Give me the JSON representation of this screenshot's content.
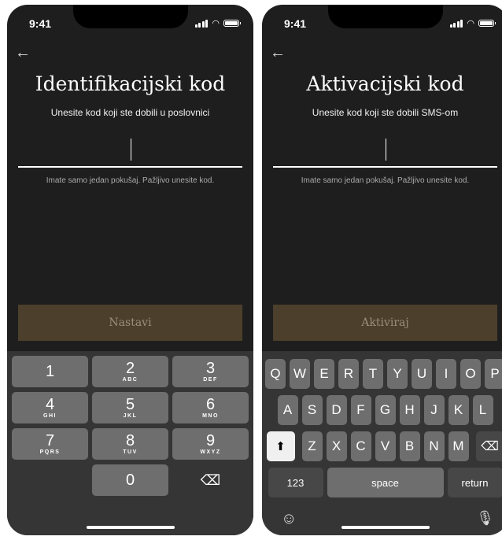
{
  "status": {
    "time": "9:41"
  },
  "screen1": {
    "title": "Identifikacijski kod",
    "subtitle": "Unesite kod koji ste dobili u poslovnici",
    "hint": "Imate samo jedan pokušaj. Pažljivo unesite kod.",
    "button_label": "Nastavi",
    "numpad": [
      [
        {
          "d": "1",
          "l": ""
        },
        {
          "d": "2",
          "l": "ABC"
        },
        {
          "d": "3",
          "l": "DEF"
        }
      ],
      [
        {
          "d": "4",
          "l": "GHI"
        },
        {
          "d": "5",
          "l": "JKL"
        },
        {
          "d": "6",
          "l": "MNO"
        }
      ],
      [
        {
          "d": "7",
          "l": "PQRS"
        },
        {
          "d": "8",
          "l": "TUV"
        },
        {
          "d": "9",
          "l": "WXYZ"
        }
      ]
    ],
    "zero": "0"
  },
  "screen2": {
    "title": "Aktivacijski kod",
    "subtitle": "Unesite kod koji ste dobili SMS-om",
    "hint": "Imate samo jedan pokušaj. Pažljivo unesite kod.",
    "button_label": "Aktiviraj",
    "keyboard_rows": [
      [
        "Q",
        "W",
        "E",
        "R",
        "T",
        "Y",
        "U",
        "I",
        "O",
        "P"
      ],
      [
        "A",
        "S",
        "D",
        "F",
        "G",
        "H",
        "J",
        "K",
        "L"
      ],
      [
        "Z",
        "X",
        "C",
        "V",
        "B",
        "N",
        "M"
      ]
    ],
    "key_123": "123",
    "key_space": "space",
    "key_return": "return"
  },
  "icons": {
    "back": "arrow-left-icon",
    "delete": "backspace-icon",
    "shift": "shift-icon",
    "emoji": "emoji-icon",
    "mic": "microphone-icon"
  },
  "colors": {
    "background": "#1e1e1e",
    "button": "#4c3f2b",
    "button_text": "#9b8e79",
    "key": "#6e6e6e"
  }
}
